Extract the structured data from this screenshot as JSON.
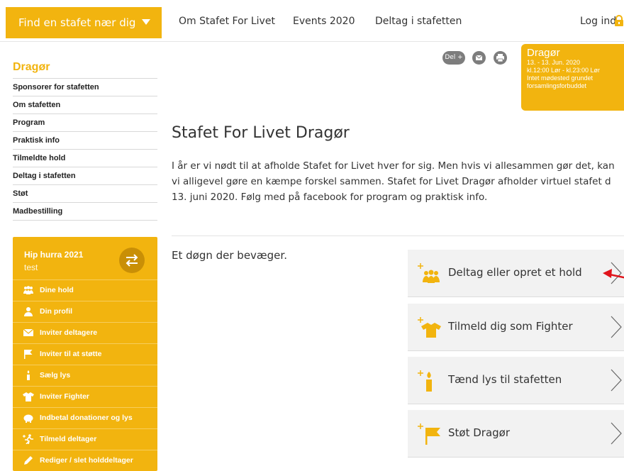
{
  "header": {
    "find_label": "Find en stafet nær dig",
    "nav": [
      "Om Stafet For Livet",
      "Events 2020",
      "Deltag i stafetten"
    ],
    "login_label": "Log ind"
  },
  "sidebar": {
    "title": "Dragør",
    "menu": [
      "Sponsorer for stafetten",
      "Om stafetten",
      "Program",
      "Praktisk info",
      "Tilmeldte hold",
      "Deltag i stafetten",
      "Støt",
      "Madbestilling"
    ]
  },
  "team_panel": {
    "team_name": "Hip hurra 2021",
    "team_sub": "test",
    "items": [
      {
        "label": "Dine hold",
        "icon": "people-icon"
      },
      {
        "label": "Din profil",
        "icon": "person-icon"
      },
      {
        "label": "Inviter deltagere",
        "icon": "envelope-icon"
      },
      {
        "label": "Inviter til at støtte",
        "icon": "flag-icon"
      },
      {
        "label": "Sælg lys",
        "icon": "candle-icon"
      },
      {
        "label": "Inviter Fighter",
        "icon": "shirt-icon"
      },
      {
        "label": "Indbetal donationer og lys",
        "icon": "piggy-bank-icon"
      },
      {
        "label": "Tilmeld deltager",
        "icon": "runner-icon"
      },
      {
        "label": "Rediger / slet holddeltager",
        "icon": "pencil-icon"
      }
    ]
  },
  "share": {
    "del_label": "Del +"
  },
  "event_card": {
    "name": "Dragør",
    "dates": "13. - 13. Jun. 2020",
    "times": "kl.12:00 Lør - kl.23:00 Lør",
    "note_1": "Intet mødested grundet",
    "note_2": "forsamlingsforbuddet"
  },
  "main": {
    "title": "Stafet For Livet Dragør",
    "intro_lines": [
      "I år er vi nødt til at afholde Stafet for Livet hver for sig. Men hvis vi allesammen gør det, kan",
      "vi alligevel gøre en kæmpe forskel sammen. Stafet for Livet Dragør afholder virtuel stafet d",
      "13. juni 2020. Følg med på facebook for program og praktisk info."
    ],
    "tagline": "Et døgn der bevæger."
  },
  "actions": [
    {
      "label": "Deltag eller opret et hold",
      "icon": "team-plus-icon"
    },
    {
      "label": "Tilmeld dig som Fighter",
      "icon": "shirt-plus-icon"
    },
    {
      "label": "Tænd lys til stafetten",
      "icon": "candle-plus-icon"
    },
    {
      "label": "Støt Dragør",
      "icon": "flag-plus-icon"
    }
  ],
  "colors": {
    "accent": "#f2b40f",
    "accent_dark": "#c98f06",
    "annotation": "#e0141b"
  }
}
